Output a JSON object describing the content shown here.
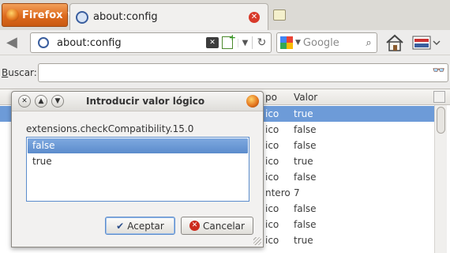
{
  "browser": {
    "app_button_label": "Firefox",
    "tab_title": "about:config",
    "url": "about:config",
    "search_placeholder": "Google"
  },
  "filter": {
    "label_prefix": "B",
    "label_rest": "uscar:",
    "value": ""
  },
  "tree": {
    "columns": [
      "Tipo",
      "Valor"
    ],
    "visible_column_fragments": [
      "po",
      "Valor"
    ],
    "rows": [
      {
        "name_fragment": "",
        "type_fragment": "ico",
        "value": "true",
        "selected": true
      },
      {
        "name_fragment": "",
        "type_fragment": "ico",
        "value": "false"
      },
      {
        "name_fragment": "",
        "type_fragment": "ico",
        "value": "false"
      },
      {
        "name_fragment": "",
        "type_fragment": "ico",
        "value": "true"
      },
      {
        "name_fragment": "",
        "type_fragment": "ico",
        "value": "false"
      },
      {
        "name_fragment": "",
        "type_fragment": "ntero",
        "value": "7"
      },
      {
        "name_fragment": "",
        "type_fragment": "ico",
        "value": "false"
      },
      {
        "name_fragment": "",
        "type_fragment": "ico",
        "value": "false"
      },
      {
        "name_fragment": "",
        "type_fragment": "ico",
        "value": "true"
      }
    ]
  },
  "dialog": {
    "title": "Introducir valor lógico",
    "pref_name": "extensions.checkCompatibility.15.0",
    "options": [
      "false",
      "true"
    ],
    "selected_option": "false",
    "accept_label": "Aceptar",
    "cancel_label": "Cancelar"
  },
  "colors": {
    "selection": "#6d9bd8",
    "firefox_orange": "#dd6a1d"
  }
}
